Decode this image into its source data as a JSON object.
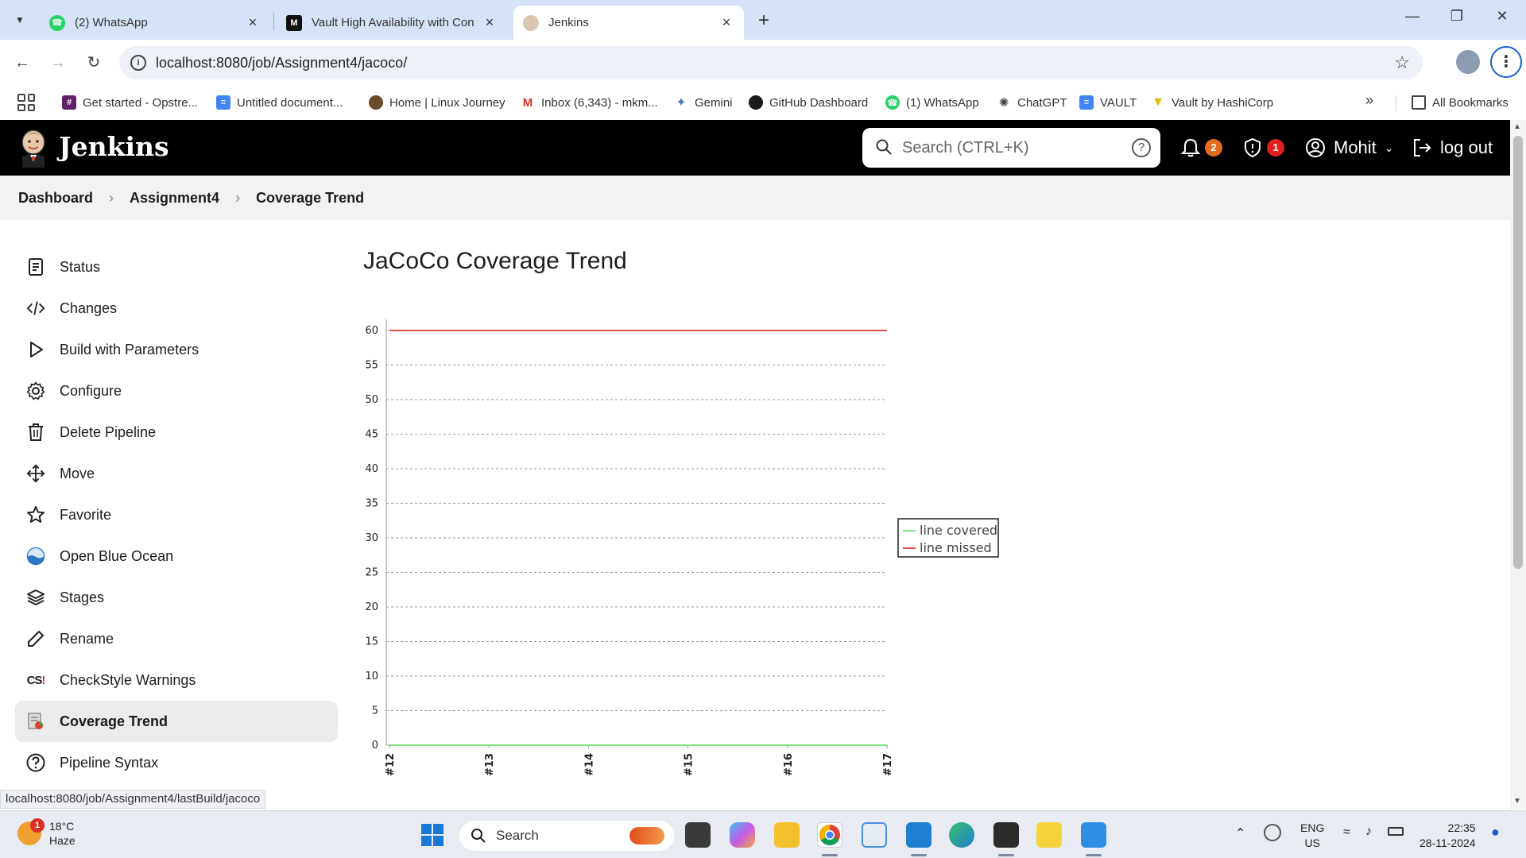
{
  "browser": {
    "tabs": [
      {
        "title": "(2) WhatsApp",
        "icon": "whatsapp-icon",
        "active": false
      },
      {
        "title": "Vault High Availability with Con",
        "icon": "medium-icon",
        "active": false
      },
      {
        "title": "Jenkins",
        "icon": "jenkins-icon",
        "active": true
      }
    ],
    "new_tab_label": "+",
    "url": "localhost:8080/job/Assignment4/jacoco/",
    "bookmarks": [
      {
        "label": "Get started - Opstre...",
        "icon": "slack-icon",
        "color": "#611f69"
      },
      {
        "label": "Untitled document...",
        "icon": "docs-icon",
        "color": "#4285f4"
      },
      {
        "label": "Home | Linux Journey",
        "icon": "linux-journey-icon",
        "color": "#6b4a2e"
      },
      {
        "label": "Inbox (6,343) - mkm...",
        "icon": "gmail-icon",
        "color": "#d93025"
      },
      {
        "label": "Gemini",
        "icon": "gemini-icon",
        "color": "#4a7bd4"
      },
      {
        "label": "GitHub Dashboard",
        "icon": "github-icon",
        "color": "#1c1c1c"
      },
      {
        "label": "(1) WhatsApp",
        "icon": "whatsapp-icon",
        "color": "#25d366"
      },
      {
        "label": "ChatGPT",
        "icon": "chatgpt-icon",
        "color": "#444444"
      },
      {
        "label": "VAULT",
        "icon": "docs-icon",
        "color": "#4285f4"
      },
      {
        "label": "Vault by HashiCorp",
        "icon": "hashicorp-vault-icon",
        "color": "#ffd814"
      }
    ],
    "all_bookmarks_label": "All Bookmarks",
    "status_url": "localhost:8080/job/Assignment4/lastBuild/jacoco"
  },
  "jenkins": {
    "brand": "Jenkins",
    "search_placeholder": "Search (CTRL+K)",
    "notifications_count": "2",
    "security_count": "1",
    "user_name": "Mohit",
    "logout_label": "log out",
    "notification_badge_color": "#e56b1f",
    "security_badge_color": "#e02020"
  },
  "breadcrumb": [
    "Dashboard",
    "Assignment4",
    "Coverage Trend"
  ],
  "sidebar": {
    "items": [
      {
        "label": "Status",
        "icon": "document-icon",
        "active": false
      },
      {
        "label": "Changes",
        "icon": "code-icon",
        "active": false
      },
      {
        "label": "Build with Parameters",
        "icon": "play-icon",
        "active": false
      },
      {
        "label": "Configure",
        "icon": "gear-icon",
        "active": false
      },
      {
        "label": "Delete Pipeline",
        "icon": "trash-icon",
        "active": false
      },
      {
        "label": "Move",
        "icon": "move-arrows-icon",
        "active": false
      },
      {
        "label": "Favorite",
        "icon": "star-icon",
        "active": false
      },
      {
        "label": "Open Blue Ocean",
        "icon": "blue-ocean-icon",
        "active": false
      },
      {
        "label": "Stages",
        "icon": "layers-icon",
        "active": false
      },
      {
        "label": "Rename",
        "icon": "pencil-icon",
        "active": false
      },
      {
        "label": "CheckStyle Warnings",
        "icon": "checkstyle-icon",
        "active": false
      },
      {
        "label": "Coverage Trend",
        "icon": "coverage-report-icon",
        "active": true
      },
      {
        "label": "Pipeline Syntax",
        "icon": "help-circle-icon",
        "active": false
      }
    ]
  },
  "main": {
    "title": "JaCoCo Coverage Trend"
  },
  "chart_data": {
    "type": "line",
    "title": "",
    "xlabel": "",
    "ylabel": "",
    "categories": [
      "#12",
      "#13",
      "#14",
      "#15",
      "#16",
      "#17"
    ],
    "series": [
      {
        "name": "line covered",
        "values": [
          0,
          0,
          0,
          0,
          0,
          0
        ],
        "color": "#7de37d"
      },
      {
        "name": "line missed",
        "values": [
          60,
          60,
          60,
          60,
          60,
          60
        ],
        "color": "#e34a4a"
      }
    ],
    "y_ticks": [
      0,
      5,
      10,
      15,
      20,
      25,
      30,
      35,
      40,
      45,
      50,
      55,
      60
    ],
    "ylim": [
      0,
      60
    ],
    "grid": true,
    "legend_position": "right"
  },
  "taskbar": {
    "weather_temp": "18°C",
    "weather_desc": "Haze",
    "weather_badge": "1",
    "search_label": "Search",
    "lang_primary": "ENG",
    "lang_secondary": "US",
    "time": "22:35",
    "date": "28-11-2024"
  }
}
